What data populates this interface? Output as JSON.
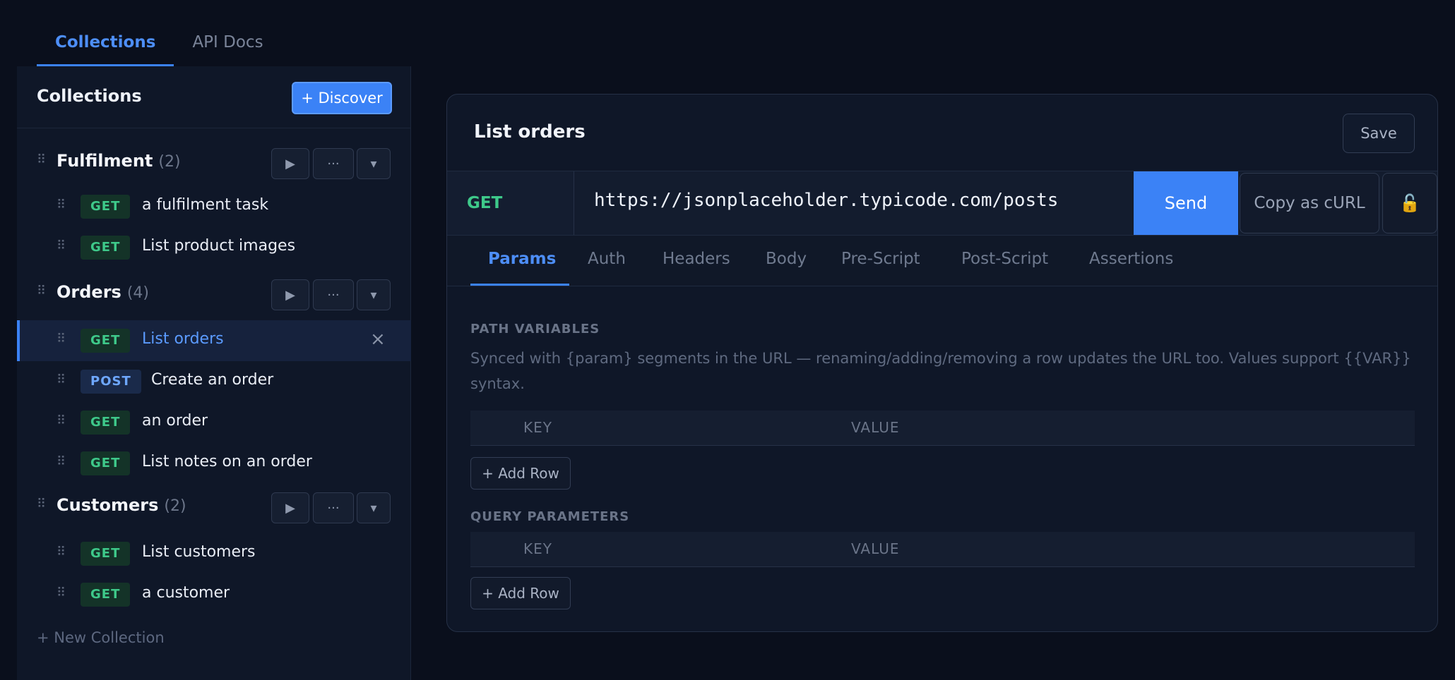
{
  "top_tabs": [
    "Collections",
    "API Docs"
  ],
  "sidebar": {
    "title": "Collections",
    "discover_label": "+ Discover",
    "new_collection": "+ New Collection",
    "group_buttons": [
      "▶",
      "···",
      "▾"
    ],
    "groups": [
      {
        "name": "Fulfilment",
        "count": "(2)",
        "items": [
          {
            "method": "GET",
            "label": "a fulfilment task"
          },
          {
            "method": "GET",
            "label": "List product images"
          }
        ]
      },
      {
        "name": "Orders",
        "count": "(4)",
        "items": [
          {
            "method": "GET",
            "label": "List orders",
            "active": true
          },
          {
            "method": "POST",
            "label": "Create an order"
          },
          {
            "method": "GET",
            "label": "an order"
          },
          {
            "method": "GET",
            "label": "List notes on an order"
          }
        ]
      },
      {
        "name": "Customers",
        "count": "(2)",
        "items": [
          {
            "method": "GET",
            "label": "List customers"
          },
          {
            "method": "GET",
            "label": "a customer"
          }
        ]
      }
    ],
    "close_icon": "×"
  },
  "request": {
    "title": "List orders",
    "save_label": "Save",
    "method": "GET",
    "url": "https://jsonplaceholder.typicode.com/posts",
    "send_label": "Send",
    "curl_label": "Copy as cURL",
    "lock_icon": "🔓"
  },
  "tabs": [
    "Params",
    "Auth",
    "Headers",
    "Body",
    "Pre-Script",
    "Post-Script",
    "Assertions"
  ],
  "params": {
    "path_label": "PATH VARIABLES",
    "path_help": "Synced with {param} segments in the URL — renaming/adding/removing a row updates the URL too. Values support {{VAR}} syntax.",
    "key_header": "KEY",
    "value_header": "VALUE",
    "add_row_label": "+ Add Row",
    "query_label": "QUERY PARAMETERS"
  },
  "colors": {
    "accent": "#3b82f6",
    "get": "#3ec98a",
    "post": "#6ea7ff",
    "background": "#0a0f1c"
  }
}
